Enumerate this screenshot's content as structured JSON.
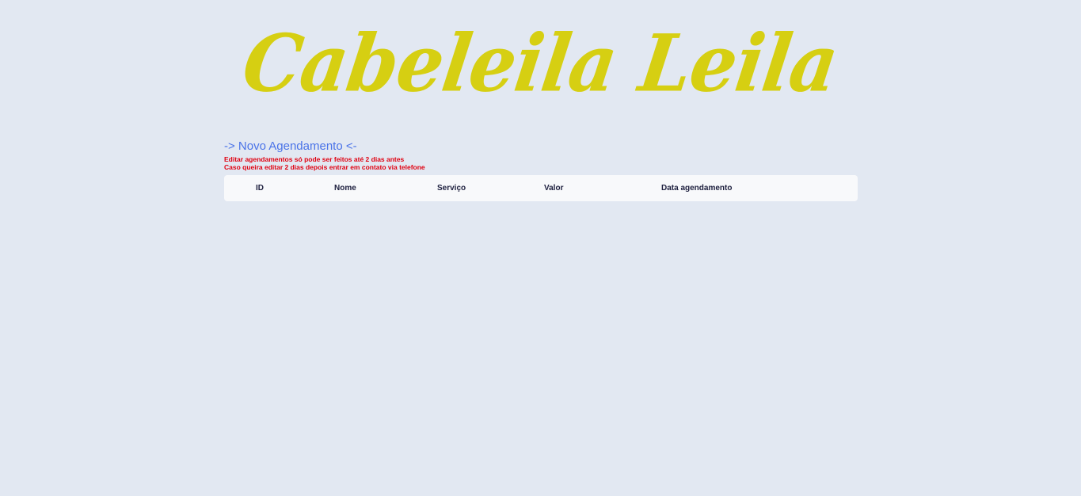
{
  "brand": {
    "logo_text": "Cabeleila Leila",
    "color": "#d6cf12"
  },
  "scheduling": {
    "new_link_label": "-> Novo Agendamento <-",
    "notice_line_1": "Editar agendamentos só pode ser feitos até 2 dias antes",
    "notice_line_2": "Caso queira editar 2 dias depois entrar em contato via telefone"
  },
  "table": {
    "columns": {
      "id": "ID",
      "nome": "Nome",
      "servico": "Serviço",
      "valor": "Valor",
      "data": "Data agendamento"
    },
    "rows": []
  },
  "colors": {
    "background": "#e2e8f2",
    "link": "#4a73e8",
    "notice": "#e00010",
    "table_header_text": "#1d1f3e"
  }
}
